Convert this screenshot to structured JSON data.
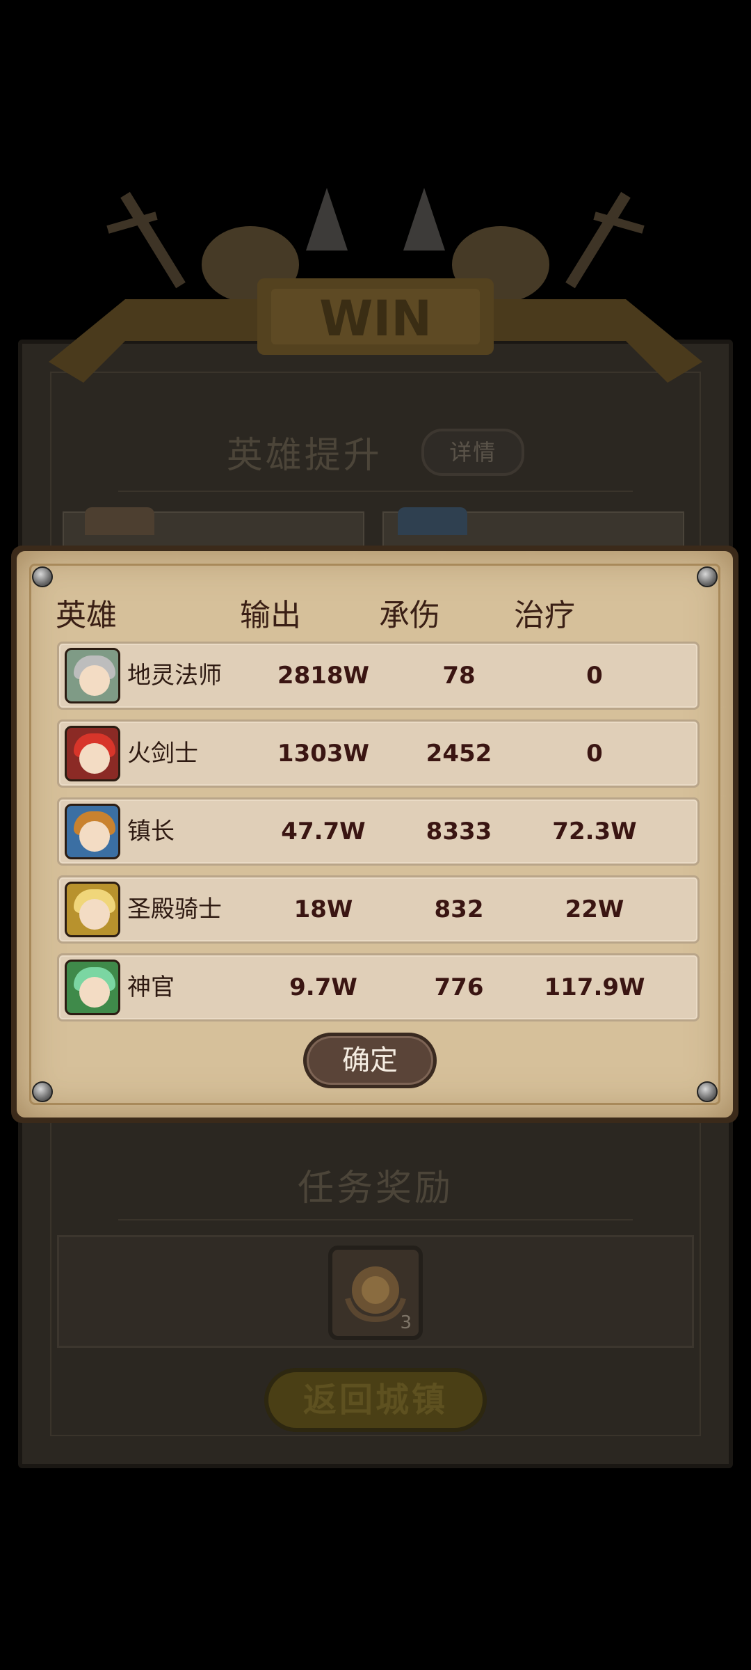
{
  "background": {
    "banner_text": "WIN",
    "hero_upgrade_title": "英雄提升",
    "detail_button": "详情",
    "mission_reward_title": "任务奖励",
    "reward_count": "3",
    "return_button": "返回城镇"
  },
  "stats": {
    "headers": {
      "hero": "英雄",
      "output": "输出",
      "damage_taken": "承伤",
      "healing": "治疗"
    },
    "rows": [
      {
        "name": "地灵法师",
        "output": "2818W",
        "taken": "78",
        "heal": "0",
        "avatar_color": "#bdbdbd",
        "avatar_bg": "#7f9b86"
      },
      {
        "name": "火剑士",
        "output": "1303W",
        "taken": "2452",
        "heal": "0",
        "avatar_color": "#d8352a",
        "avatar_bg": "#8b2a25"
      },
      {
        "name": "镇长",
        "output": "47.7W",
        "taken": "8333",
        "heal": "72.3W",
        "avatar_color": "#c9822f",
        "avatar_bg": "#3b6fa3"
      },
      {
        "name": "圣殿骑士",
        "output": "18W",
        "taken": "832",
        "heal": "22W",
        "avatar_color": "#f0d67a",
        "avatar_bg": "#b8922d"
      },
      {
        "name": "神官",
        "output": "9.7W",
        "taken": "776",
        "heal": "117.9W",
        "avatar_color": "#7bd6a2",
        "avatar_bg": "#3f8a4a"
      }
    ],
    "confirm_button": "确定"
  }
}
